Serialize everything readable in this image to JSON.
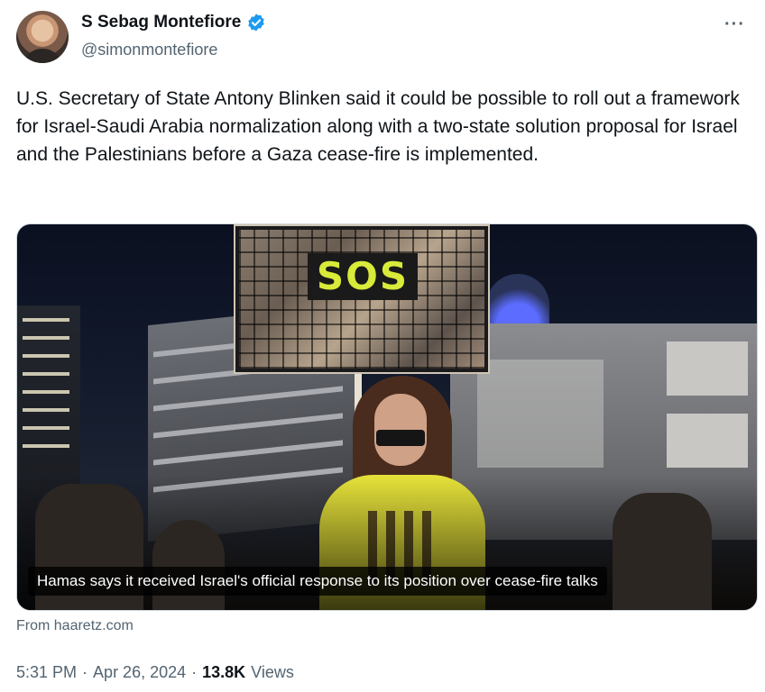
{
  "author": {
    "name": "S Sebag Montefiore",
    "handle": "@simonmontefiore",
    "verified": true,
    "avatar_icon": "profile-photo"
  },
  "more_icon": "more-options-icon",
  "tweet": {
    "text": "U.S. Secretary of State Antony Blinken said it could be possible to roll out a framework for Israel-Saudi Arabia normalization along with a two-state solution proposal for Israel and the Palestinians before a Gaza cease-fire is implemented."
  },
  "media": {
    "sign_text": "SOS",
    "caption": "Hamas says it received Israel's official response to its position over cease-fire talks",
    "source": "From haaretz.com"
  },
  "meta": {
    "time": "5:31 PM",
    "date": "Apr 26, 2024",
    "sep1": "·",
    "sep2": "·",
    "views_count": "13.8K",
    "views_label": "Views"
  },
  "colors": {
    "verified": "#1d9bf0",
    "secondary_text": "#536471",
    "primary_text": "#0f1419"
  }
}
